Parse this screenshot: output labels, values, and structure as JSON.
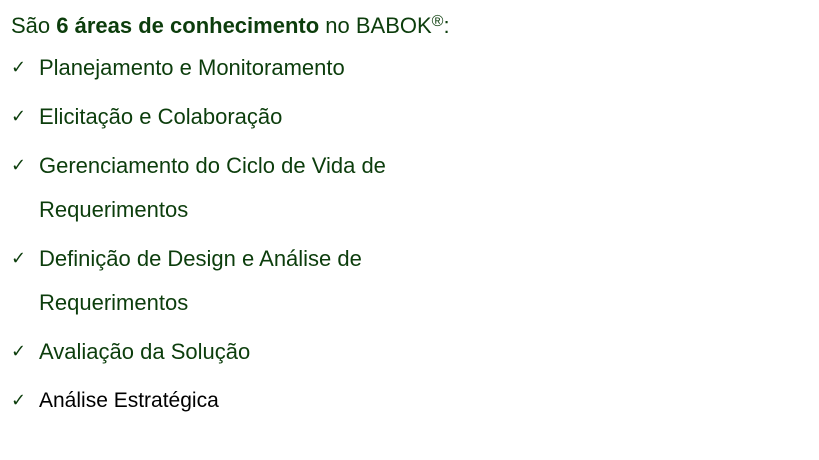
{
  "intro": {
    "prefix": "São ",
    "bold": "6 áreas de conhecimento",
    "suffix": " no BABOK",
    "registered": "®",
    "colon": ":"
  },
  "areas": [
    "Planejamento e Monitoramento",
    "Elicitação e Colaboração",
    "Gerenciamento do Ciclo de Vida de Requerimentos",
    "Definição de Design e Análise de Requerimentos",
    "Avaliação da Solução",
    "Análise Estratégica"
  ],
  "check_icon": "checkmark-icon",
  "colors": {
    "text": "#0c3d0c",
    "last_item": "#000000"
  }
}
